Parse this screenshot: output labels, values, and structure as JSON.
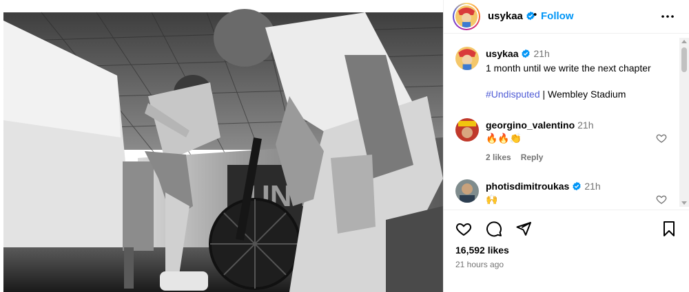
{
  "post": {
    "username": "usykaa",
    "follow_label": "Follow",
    "separator": "•"
  },
  "caption": {
    "username": "usykaa",
    "time": "21h",
    "line1": "1 month until we write the next chapter",
    "hashtag": "#Undisputed",
    "rest": " | Wembley Stadium"
  },
  "comments": [
    {
      "username": "georgino_valentino",
      "time": "21h",
      "text": "🔥🔥👏",
      "likes": "2 likes",
      "reply": "Reply"
    },
    {
      "username": "photisdimitroukas",
      "time": "21h",
      "text": "🙌"
    }
  ],
  "stats": {
    "likes": "16,592 likes",
    "ago": "21 hours ago"
  },
  "colors": {
    "link": "#0095f6",
    "hashtag": "#4f5bd5",
    "muted": "#737373",
    "verified": "#0095f6"
  },
  "icons": {
    "like": "heart-icon",
    "comment": "comment-icon",
    "share": "share-icon",
    "save": "bookmark-icon",
    "more": "more-options-icon",
    "verified": "verified-badge-icon"
  }
}
